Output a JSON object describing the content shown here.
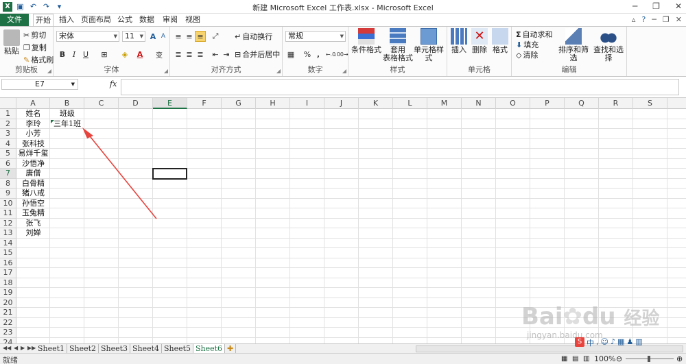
{
  "window": {
    "title": "新建 Microsoft Excel 工作表.xlsx - Microsoft Excel"
  },
  "tabs": [
    {
      "label": "文件"
    },
    {
      "label": "开始"
    },
    {
      "label": "插入"
    },
    {
      "label": "页面布局"
    },
    {
      "label": "公式"
    },
    {
      "label": "数据"
    },
    {
      "label": "审阅"
    },
    {
      "label": "视图"
    }
  ],
  "ribbon": {
    "clipboard": {
      "paste": "粘贴",
      "cut": "剪切",
      "copy": "复制",
      "format_painter": "格式刷",
      "label": "剪贴板"
    },
    "font": {
      "name": "宋体",
      "size": "11",
      "bold": "B",
      "italic": "I",
      "underline": "U",
      "label": "字体",
      "grow": "A",
      "shrink": "A",
      "font_color": "A",
      "wen": "变"
    },
    "alignment": {
      "wrap": "自动换行",
      "merge": "合并后居中",
      "label": "对齐方式"
    },
    "number": {
      "format": "常规",
      "percent": "%",
      "comma": ",",
      "label": "数字"
    },
    "styles": {
      "conditional": "条件格式",
      "table_l1": "套用",
      "table_l2": "表格格式",
      "cell_styles": "单元格样式",
      "label": "样式"
    },
    "cells": {
      "insert": "插入",
      "delete": "删除",
      "format": "格式",
      "label": "单元格"
    },
    "editing": {
      "autosum": "自动求和",
      "fill": "填充",
      "clear": "清除",
      "sort": "排序和筛选",
      "find": "查找和选择",
      "label": "编辑"
    }
  },
  "formula_bar": {
    "name_box": "E7",
    "fx": "fx",
    "value": ""
  },
  "columns": [
    "A",
    "B",
    "C",
    "D",
    "E",
    "F",
    "G",
    "H",
    "I",
    "J",
    "K",
    "L",
    "M",
    "N",
    "O",
    "P",
    "Q",
    "R",
    "S"
  ],
  "rows": [
    "1",
    "2",
    "3",
    "4",
    "5",
    "6",
    "7",
    "8",
    "9",
    "10",
    "11",
    "12",
    "13",
    "14",
    "15",
    "16",
    "17",
    "18",
    "19",
    "20",
    "21",
    "22",
    "23",
    "24"
  ],
  "cells": {
    "A1": "姓名",
    "B1": "班级",
    "A2": "李玲",
    "B2": "三年1班",
    "A3": "小芳",
    "A4": "张科技",
    "A5": "易烊千玺",
    "A6": "沙悟净",
    "A7": "唐僧",
    "A8": "白骨精",
    "A9": "猪八戒",
    "A10": "孙悟空",
    "A11": "玉兔精",
    "A12": "张飞",
    "A13": "刘婵"
  },
  "active_cell": "E7",
  "sheets": [
    "Sheet1",
    "Sheet2",
    "Sheet3",
    "Sheet4",
    "Sheet5",
    "Sheet6"
  ],
  "active_sheet": "Sheet6",
  "status": {
    "text": "就绪",
    "zoom": "100%"
  },
  "watermark": {
    "brand": "Bai",
    "brand2": "du",
    "cn": "经验",
    "url": "jingyan.baidu.com"
  },
  "colors": {
    "excel_green": "#1e7145",
    "annotation_red": "#e8433d"
  }
}
